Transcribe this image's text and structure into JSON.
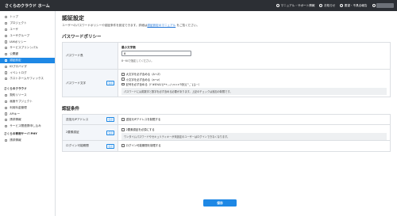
{
  "topbar": {
    "brand": "さくらのクラウド ホーム",
    "manual": "マニュアル・サポート情報",
    "notice": "お知らせ",
    "feedback": "要望・不具合報告"
  },
  "sidebar": {
    "items": [
      {
        "label": "トップ",
        "active": false
      },
      {
        "label": "プロジェクト",
        "active": false
      },
      {
        "label": "ユーザ",
        "active": false
      },
      {
        "label": "ユーザグループ",
        "active": false
      },
      {
        "label": "IAMポリシー",
        "active": false
      },
      {
        "label": "サービスプリンシパル",
        "active": false
      },
      {
        "label": "公開鍵",
        "active": false
      },
      {
        "label": "認証設定",
        "active": true
      },
      {
        "label": "IDプロバイダ",
        "active": false
      },
      {
        "label": "イベントログ",
        "active": false
      },
      {
        "label": "ホストネームサフィックス",
        "active": false
      }
    ],
    "section2_title": "さくらのクラウド",
    "items2": [
      {
        "label": "契約リソース"
      },
      {
        "label": "画面サブジェクト"
      },
      {
        "label": "利用料金管理"
      },
      {
        "label": "APIキー"
      },
      {
        "label": "請求情報"
      },
      {
        "label": "サービス間連携申し込み"
      }
    ],
    "section3_title": "さくらの専用サーバ PHY",
    "items3": [
      {
        "label": "請求情報"
      }
    ]
  },
  "main": {
    "title": "認証設定",
    "desc_prefix": "ユーザーのパスワードポリシーや認証条件を設定できます。詳細は",
    "desc_link": "認証設定のマニュアル",
    "desc_suffix": " をご覧ください。",
    "password_policy_title": "パスワードポリシー",
    "password_length": {
      "label": "パスワード長",
      "sub_title": "最小文字数",
      "value": "8",
      "help": "8~64で指定してください。"
    },
    "password_chars": {
      "label": "パスワード文字",
      "badge": "任意",
      "options": [
        "大文字を必ず含める（A～Z）",
        "小文字を必ず含める（a～z）",
        "記号を必ず含める（!\"#$%&'()*+,-./:;<=>?@[\\]^_`{|}~）"
      ],
      "note": "パスワードには英数字と数字を必ず含める必要があります。上記のチェックは追加の制限です。"
    },
    "auth_conditions_title": "認証条件",
    "auth_rows": [
      {
        "label": "送信元IPアドレス",
        "badge": "任意",
        "option": "送信元IPアドレスを制限する",
        "note": ""
      },
      {
        "label": "2要素認証",
        "badge": "任意",
        "option": "2要素認証を必須にする",
        "note": "ワンタイムパスワードやセキュリティキーが未設定のユーザーはログインできなくなります。"
      },
      {
        "label": "ログイン可能期間",
        "badge": "任意",
        "option": "ログイン可能期間を制限する",
        "note": ""
      }
    ],
    "save_label": "保存"
  }
}
